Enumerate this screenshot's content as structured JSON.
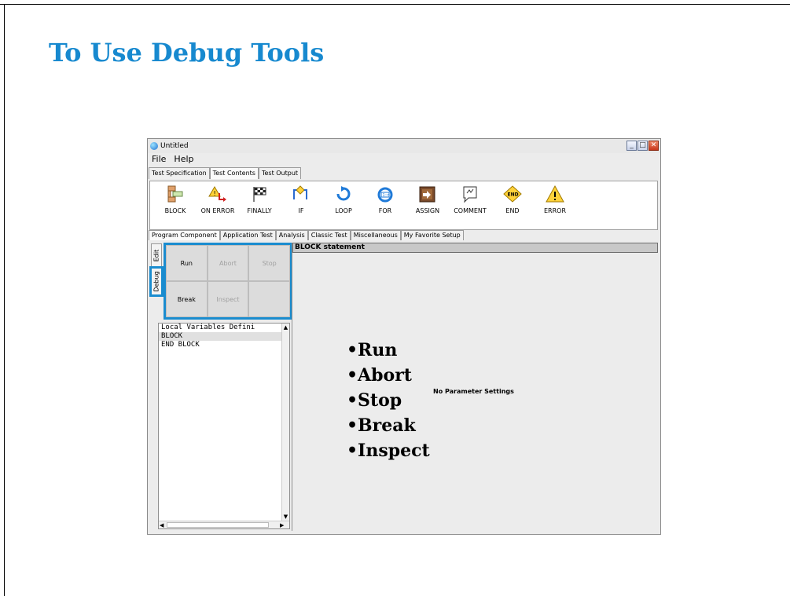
{
  "slide": {
    "title": "To Use Debug Tools"
  },
  "window": {
    "title": "Untitled",
    "buttons": [
      "_",
      "□",
      "✕"
    ]
  },
  "menu": [
    "File",
    "Help"
  ],
  "top_tabs": [
    {
      "label": "Test Specification",
      "active": false
    },
    {
      "label": "Test Contents",
      "active": true
    },
    {
      "label": "Test Output",
      "active": false
    }
  ],
  "toolbar": [
    {
      "label": "BLOCK",
      "icon": "block-icon"
    },
    {
      "label": "ON ERROR",
      "icon": "on-error-icon"
    },
    {
      "label": "FINALLY",
      "icon": "finally-flag-icon"
    },
    {
      "label": "IF",
      "icon": "if-branch-icon"
    },
    {
      "label": "LOOP",
      "icon": "loop-icon"
    },
    {
      "label": "FOR",
      "icon": "for-icon"
    },
    {
      "label": "ASSIGN",
      "icon": "assign-icon"
    },
    {
      "label": "COMMENT",
      "icon": "comment-icon"
    },
    {
      "label": "END",
      "icon": "end-icon"
    },
    {
      "label": "ERROR",
      "icon": "error-warning-icon"
    }
  ],
  "second_tabs": [
    {
      "label": "Program Component",
      "active": true
    },
    {
      "label": "Application Test",
      "active": false
    },
    {
      "label": "Analysis",
      "active": false
    },
    {
      "label": "Classic Test",
      "active": false
    },
    {
      "label": "Miscellaneous",
      "active": false
    },
    {
      "label": "My Favorite Setup",
      "active": false
    }
  ],
  "side_tabs": {
    "edit": "Edit",
    "debug": "Debug"
  },
  "debug_buttons": [
    {
      "label": "Run",
      "enabled": true
    },
    {
      "label": "Abort",
      "enabled": false
    },
    {
      "label": "Stop",
      "enabled": false
    },
    {
      "label": "Break",
      "enabled": true
    },
    {
      "label": "Inspect",
      "enabled": false
    },
    {
      "label": "",
      "enabled": false
    }
  ],
  "tree_lines": [
    "Local Variables Defini",
    "BLOCK",
    "END BLOCK"
  ],
  "right_header": "BLOCK statement",
  "no_param": "No Parameter Settings",
  "bullets": [
    "•Run",
    "•Abort",
    "•Stop",
    "•Break",
    "•Inspect"
  ],
  "colors": {
    "accent": "#1a8ccf",
    "title": "#1789cf"
  }
}
